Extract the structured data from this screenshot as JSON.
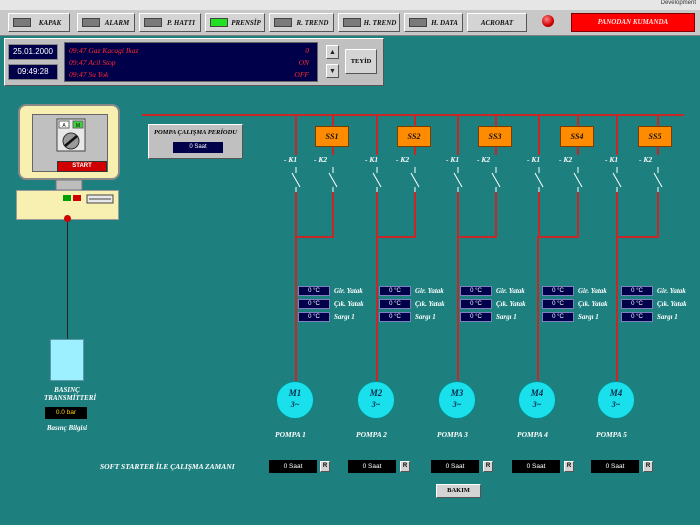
{
  "app": {
    "corner_label": "Development"
  },
  "nav": {
    "buttons": [
      {
        "label": "KAPAK",
        "led": true,
        "led_on": false
      },
      {
        "label": "ALARM",
        "led": true,
        "led_on": false
      },
      {
        "label": "P. HATTI",
        "led": true,
        "led_on": false
      },
      {
        "label": "PRENSİP",
        "led": true,
        "led_on": true
      },
      {
        "label": "R. TREND",
        "led": true,
        "led_on": false
      },
      {
        "label": "H. TREND",
        "led": true,
        "led_on": false
      },
      {
        "label": "H. DATA",
        "led": true,
        "led_on": false
      },
      {
        "label": "ACROBAT",
        "led": false,
        "led_on": false
      }
    ],
    "kumanda_label": "PANODAN KUMANDA"
  },
  "events": {
    "date": "25.01.2000",
    "time": "09:49:28",
    "rows": [
      {
        "text": "09:47 Gaz Kacagi Ikaz",
        "state": "0"
      },
      {
        "text": "09:47 Acil Stop",
        "state": "ON"
      },
      {
        "text": "09:47 Su Yok",
        "state": "OFF"
      }
    ],
    "up_icon": "▲",
    "down_icon": "▼",
    "confirm_label": "TEYİD"
  },
  "period": {
    "title": "POMPA ÇALIŞMA PERİODU",
    "value": "0 Saat"
  },
  "pc": {
    "start_label": "START"
  },
  "transmitter": {
    "title": "BASINÇ\nTRANSMİTTERİ",
    "value": "0.0 bar",
    "caption": "Basınç Bilgisi"
  },
  "contactors": {
    "k1_label": "- K1",
    "k2_label": "- K2"
  },
  "temp_labels": [
    "Gir. Yatak",
    "Çık. Yatak",
    "Sargı 1"
  ],
  "pumps": [
    {
      "ss": "SS1",
      "motor": "M1",
      "phase": "3~",
      "name": "POMPA 1",
      "temps": [
        "0 °C",
        "0 °C",
        "0 °C"
      ],
      "soft": "0 Saat"
    },
    {
      "ss": "SS2",
      "motor": "M2",
      "phase": "3~",
      "name": "POMPA 2",
      "temps": [
        "0 °C",
        "0 °C",
        "0 °C"
      ],
      "soft": "0 Saat"
    },
    {
      "ss": "SS3",
      "motor": "M3",
      "phase": "3~",
      "name": "POMPA 3",
      "temps": [
        "0 °C",
        "0 °C",
        "0 °C"
      ],
      "soft": "0 Saat"
    },
    {
      "ss": "SS4",
      "motor": "M4",
      "phase": "3~",
      "name": "POMPA 4",
      "temps": [
        "0 °C",
        "0 °C",
        "0 °C"
      ],
      "soft": "0 Saat"
    },
    {
      "ss": "SS5",
      "motor": "M4",
      "phase": "3~",
      "name": "POMPA 5",
      "temps": [
        "0 °C",
        "0 °C",
        "0 °C"
      ],
      "soft": "0 Saat"
    }
  ],
  "soft_starter": {
    "label": "SOFT STARTER İLE ÇALIŞMA ZAMANI",
    "reset_label": "R"
  },
  "maintenance": {
    "label": "BAKIM"
  },
  "colors": {
    "background": "#1e7f7f",
    "bus_wire": "#c62828",
    "starter": "#ff8c00",
    "motor": "#19e0ea",
    "alarm": "#ff0000"
  }
}
